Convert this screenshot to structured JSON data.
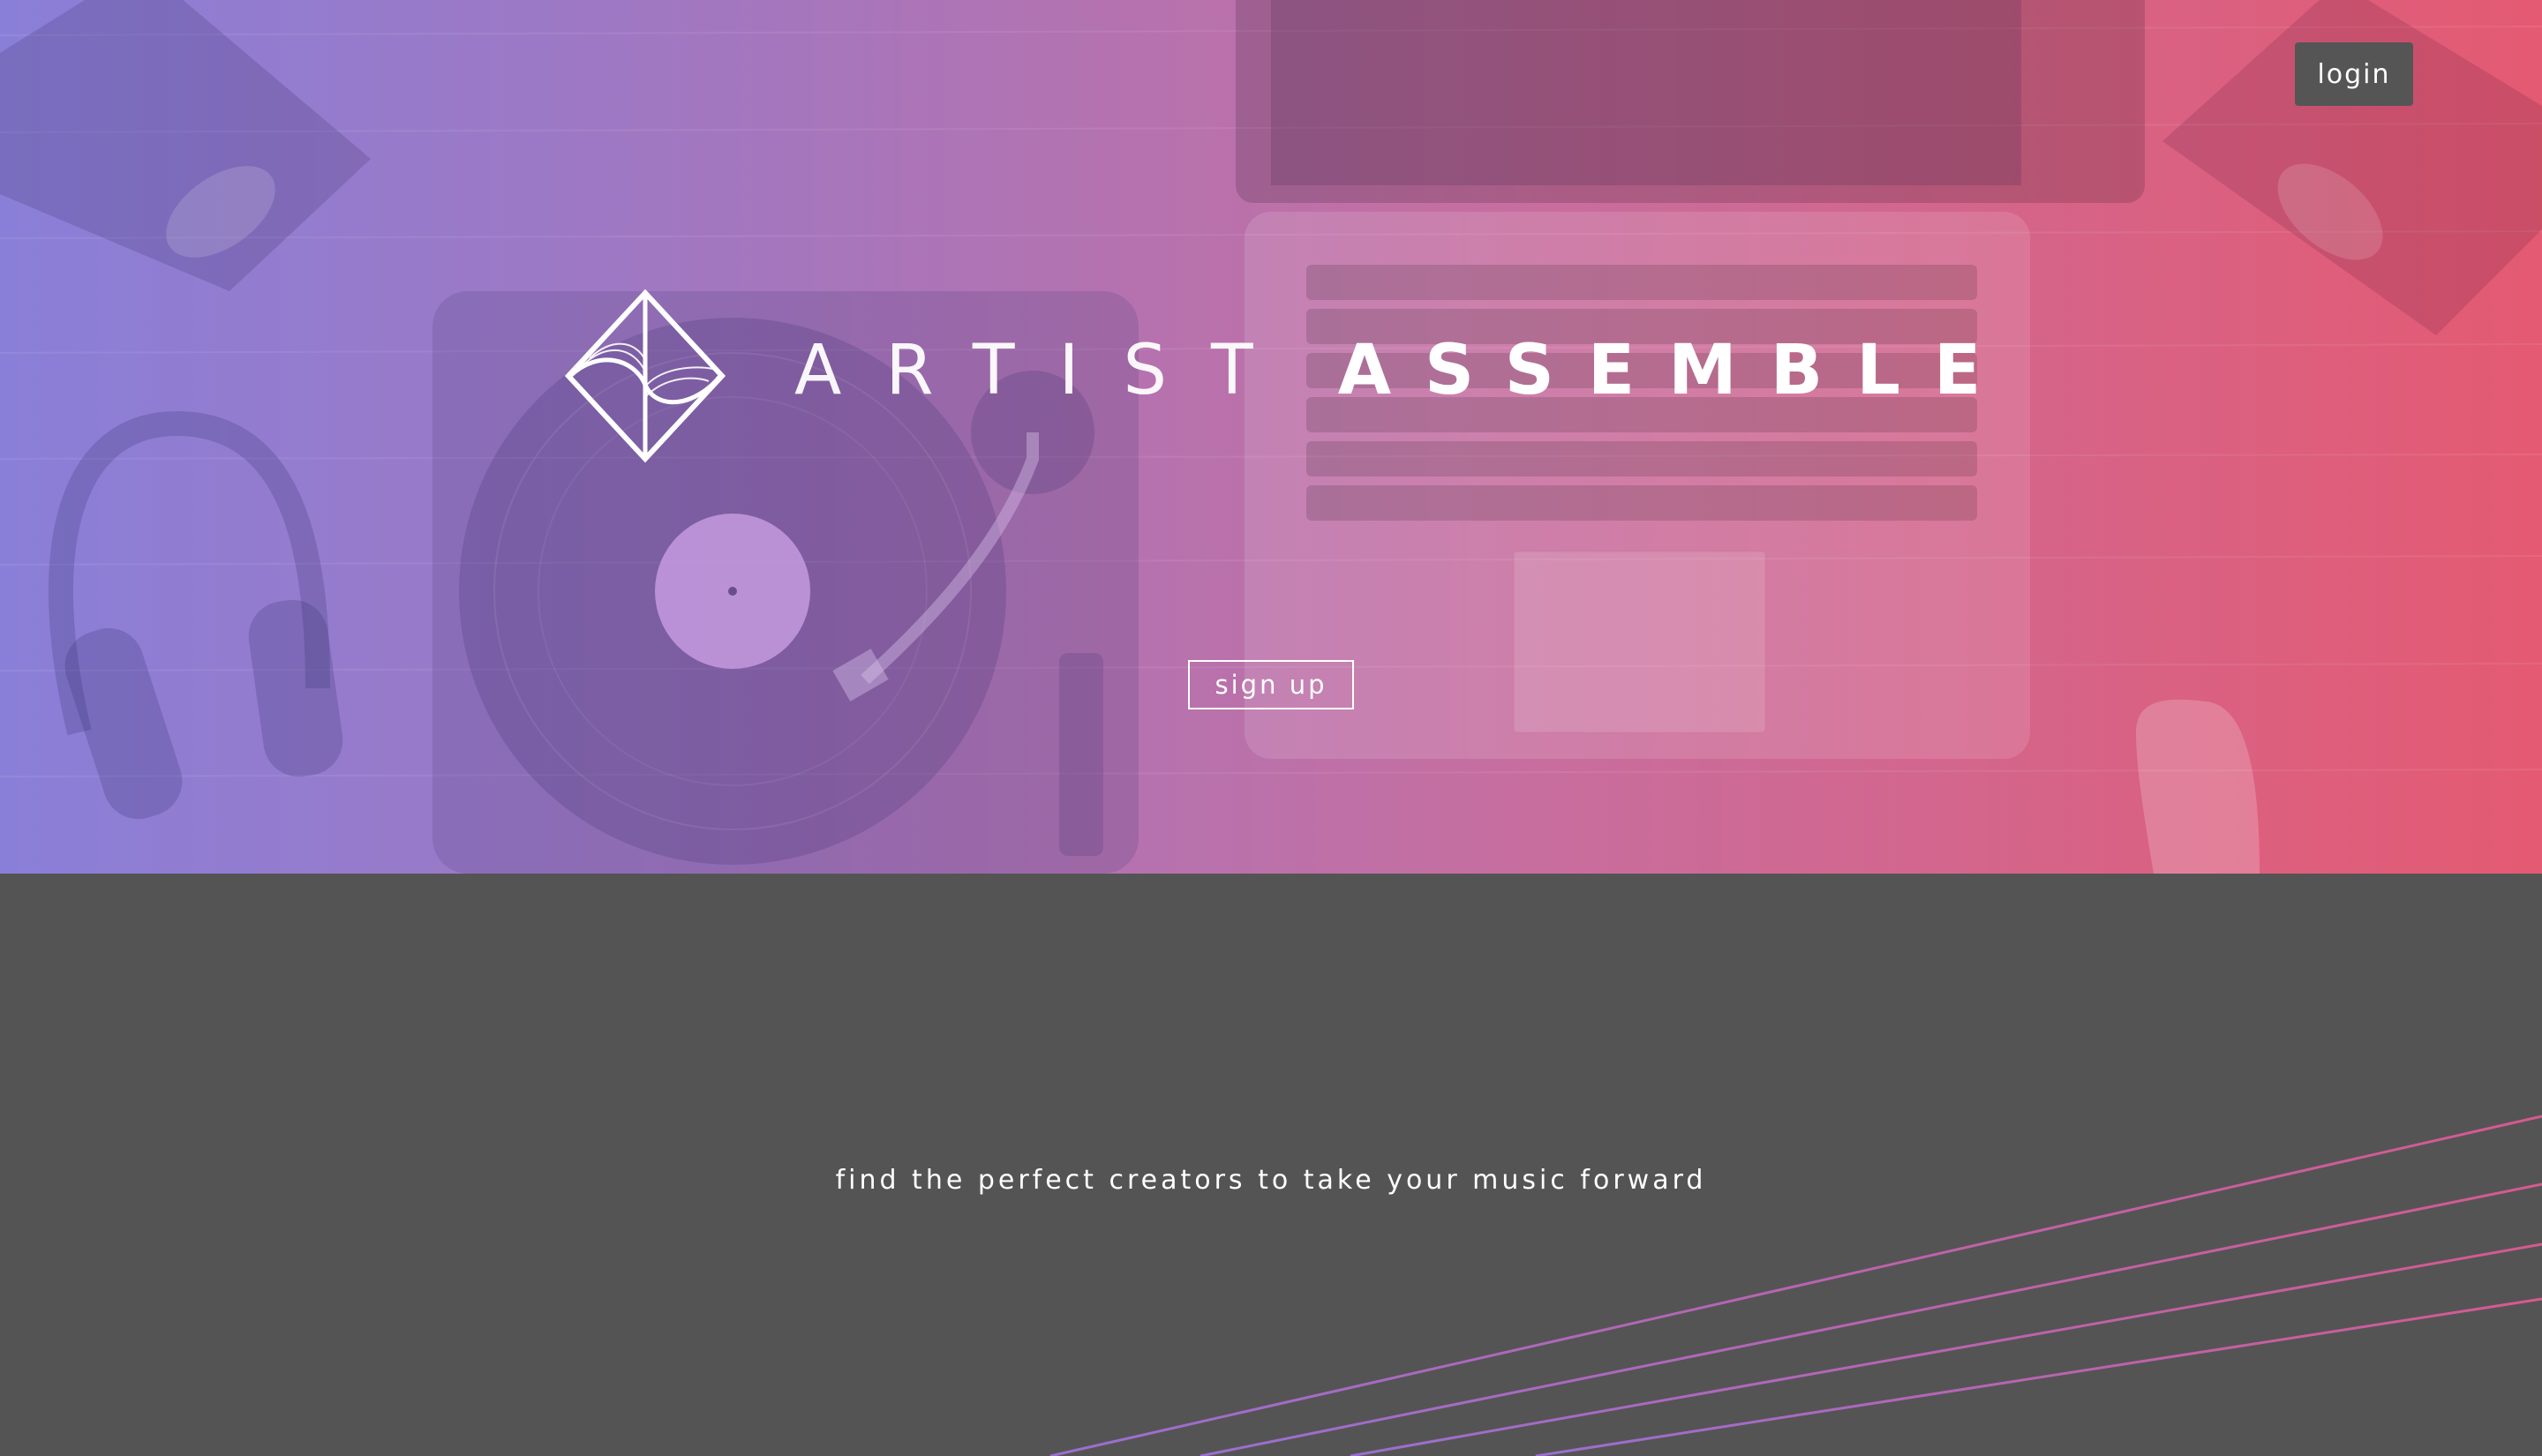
{
  "header": {
    "login_label": "login"
  },
  "hero": {
    "brand_word_1": "ARTIST",
    "brand_word_2": "ASSEMBLE",
    "signup_label": "sign up",
    "logo_icon": "diamond-logo-icon",
    "gradient_colors": [
      "#8a7fd8",
      "#a277c0",
      "#c76e9f",
      "#e45a72"
    ]
  },
  "main": {
    "tagline": "find the perfect creators to take your music forward"
  },
  "colors": {
    "login_bg": "#555555",
    "page_bg": "#545454",
    "line_start": "#9a6fd0",
    "line_end": "#d65a90"
  }
}
